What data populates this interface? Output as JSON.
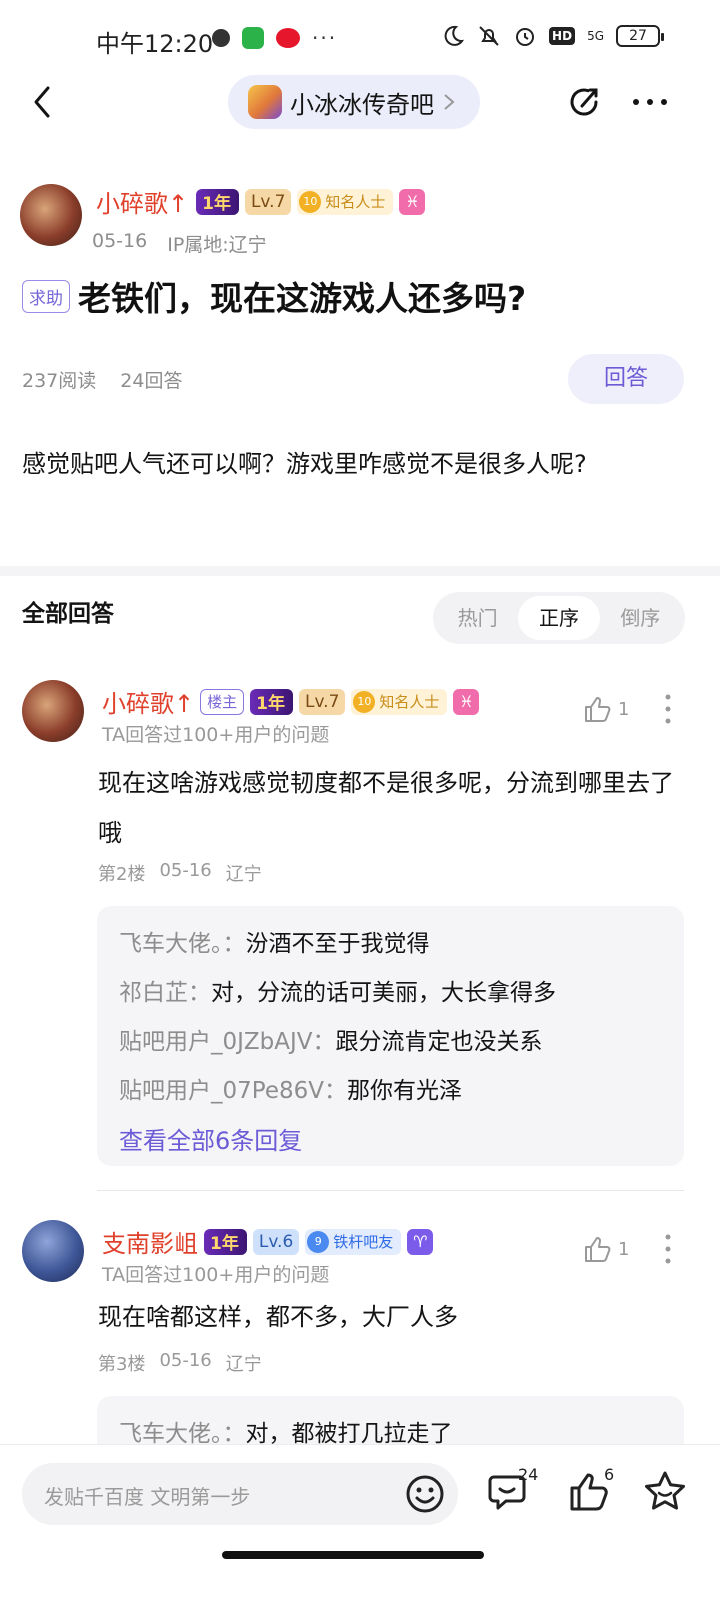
{
  "status_bar": {
    "time": "中午12:20",
    "battery": "27",
    "more": "···",
    "network": "5G",
    "hd": "HD"
  },
  "nav": {
    "forum_name": "小冰冰传奇吧"
  },
  "post": {
    "author": {
      "name": "小碎歌↑",
      "year_badge": "1年",
      "level": "Lv.7",
      "fame_level": "10",
      "fame_title": "知名人士",
      "zodiac": "♓"
    },
    "date": "05-16",
    "ip": "IP属地:辽宁",
    "tag": "求助",
    "title": "老铁们，现在这游戏人还多吗?",
    "reads": "237阅读",
    "answers": "24回答",
    "answer_button": "回答",
    "body": "感觉贴吧人气还可以啊？游戏里咋感觉不是很多人呢?"
  },
  "answers_section": {
    "title": "全部回答",
    "sort_tabs": [
      "热门",
      "正序",
      "倒序"
    ],
    "active_sort": "正序"
  },
  "replies": [
    {
      "name": "小碎歌↑",
      "owner_badge": "楼主",
      "year_badge": "1年",
      "level": "Lv.7",
      "fame_level": "10",
      "fame_title": "知名人士",
      "zodiac": "♓",
      "subtitle": "TA回答过100+用户的问题",
      "likes": "1",
      "body": "现在这啥游戏感觉韧度都不是很多呢，分流到哪里去了哦",
      "floor": "第2楼",
      "date": "05-16",
      "location": "辽宁",
      "sub_replies": [
        {
          "who": "飞车大佬。：",
          "text": "汾酒不至于我觉得"
        },
        {
          "who": "祁白芷：",
          "text": "对，分流的话可美丽，大长拿得多"
        },
        {
          "who": "贴吧用户_0JZbAJV：",
          "text": "跟分流肯定也没关系"
        },
        {
          "who": "贴吧用户_07Pe86V：",
          "text": "那你有光泽"
        }
      ],
      "view_all": "查看全部6条回复"
    },
    {
      "name": "支南影岨",
      "year_badge": "1年",
      "level": "Lv.6",
      "fan_level": "9",
      "fan_title": "铁杆吧友",
      "zodiac": "♈",
      "subtitle": "TA回答过100+用户的问题",
      "likes": "1",
      "body": "现在啥都这样，都不多，大厂人多",
      "floor": "第3楼",
      "date": "05-16",
      "location": "辽宁",
      "sub_replies": [
        {
          "who": "飞车大佬。：",
          "text": "对，都被打几拉走了"
        }
      ]
    }
  ],
  "bottom_bar": {
    "compose_placeholder": "发贴千百度 文明第一步",
    "comment_count": "24",
    "like_count": "6"
  },
  "colors": {
    "accent": "#6b5bd6",
    "username": "#e0412c",
    "muted": "#999999"
  }
}
